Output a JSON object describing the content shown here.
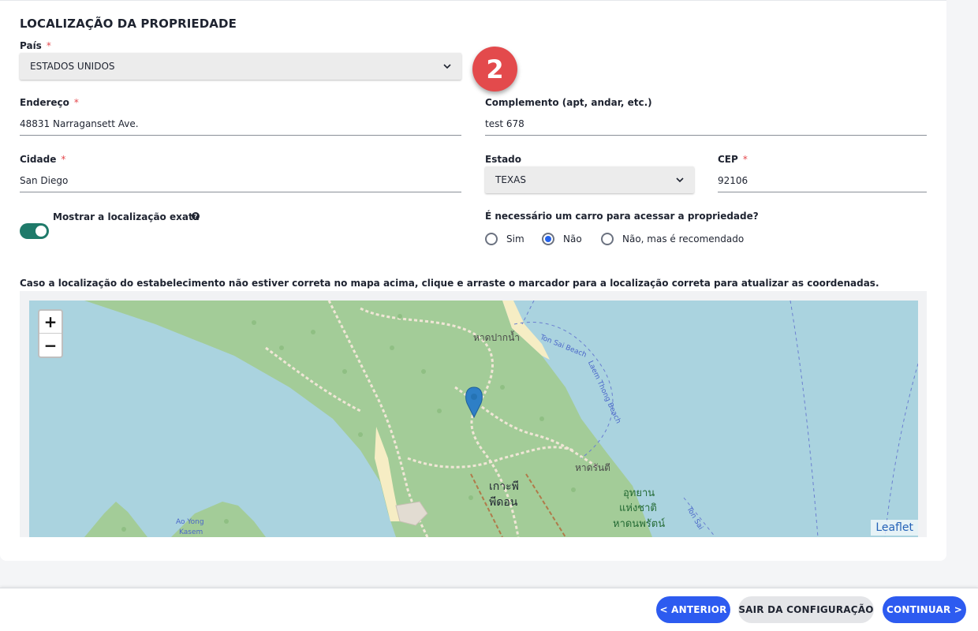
{
  "section": {
    "title": "LOCALIZAÇÃO DA PROPRIEDADE"
  },
  "badge": {
    "number": "2"
  },
  "country": {
    "label": "País",
    "required": "*",
    "value": "ESTADOS UNIDOS"
  },
  "address": {
    "label": "Endereço",
    "required": "*",
    "value": "48831 Narragansett Ave."
  },
  "complement": {
    "label": "Complemento (apt, andar, etc.)",
    "value": "test 678"
  },
  "city": {
    "label": "Cidade",
    "required": "*",
    "value": "San Diego"
  },
  "state": {
    "label": "Estado",
    "value": "TEXAS"
  },
  "zip": {
    "label": "CEP",
    "required": "*",
    "value": "92106"
  },
  "exact_location": {
    "label": "Mostrar a localização exata",
    "help": "?",
    "enabled": true
  },
  "car_question": {
    "label": "É necessário um carro para acessar a propriedade?",
    "options": [
      "Sim",
      "Não",
      "Não, mas é recomendado"
    ],
    "selected": "Não"
  },
  "map": {
    "caption": "Caso a localização do estabelecimento não estiver correta no mapa acima, clique e arraste o marcador para a localização correta para atualizar as coordenadas.",
    "zoom_in": "+",
    "zoom_out": "−",
    "attribution": "Leaflet",
    "labels": {
      "beach_1": "หาดปากน้ำ",
      "ton_sai": "Ton Sai Beach",
      "laem_thong": "Laem Thong Beach",
      "beach_2": "หาดรันตี",
      "island_1": "เกาะพี",
      "island_2": "พีดอน",
      "park_1": "อุทยาน",
      "park_2": "แห่งชาติ",
      "park_3": "หาดนพรัตน์",
      "ao_yong_1": "Ao Yong",
      "ao_yong_2": "Kasem",
      "ton_sai_2": "Ton Sai"
    },
    "colors": {
      "water": "#aad3df",
      "land": "#a3cc98",
      "beach": "#f6edc4",
      "path": "#f0e6d6"
    }
  },
  "footer": {
    "prev": "< ANTERIOR",
    "exit": "SAIR DA CONFIGURAÇÃO",
    "next": "CONTINUAR >"
  },
  "colors": {
    "accent": "#2d5bf0",
    "required": "#e5484d",
    "badge": "#e34a4c",
    "toggle": "#1f7a6a"
  }
}
